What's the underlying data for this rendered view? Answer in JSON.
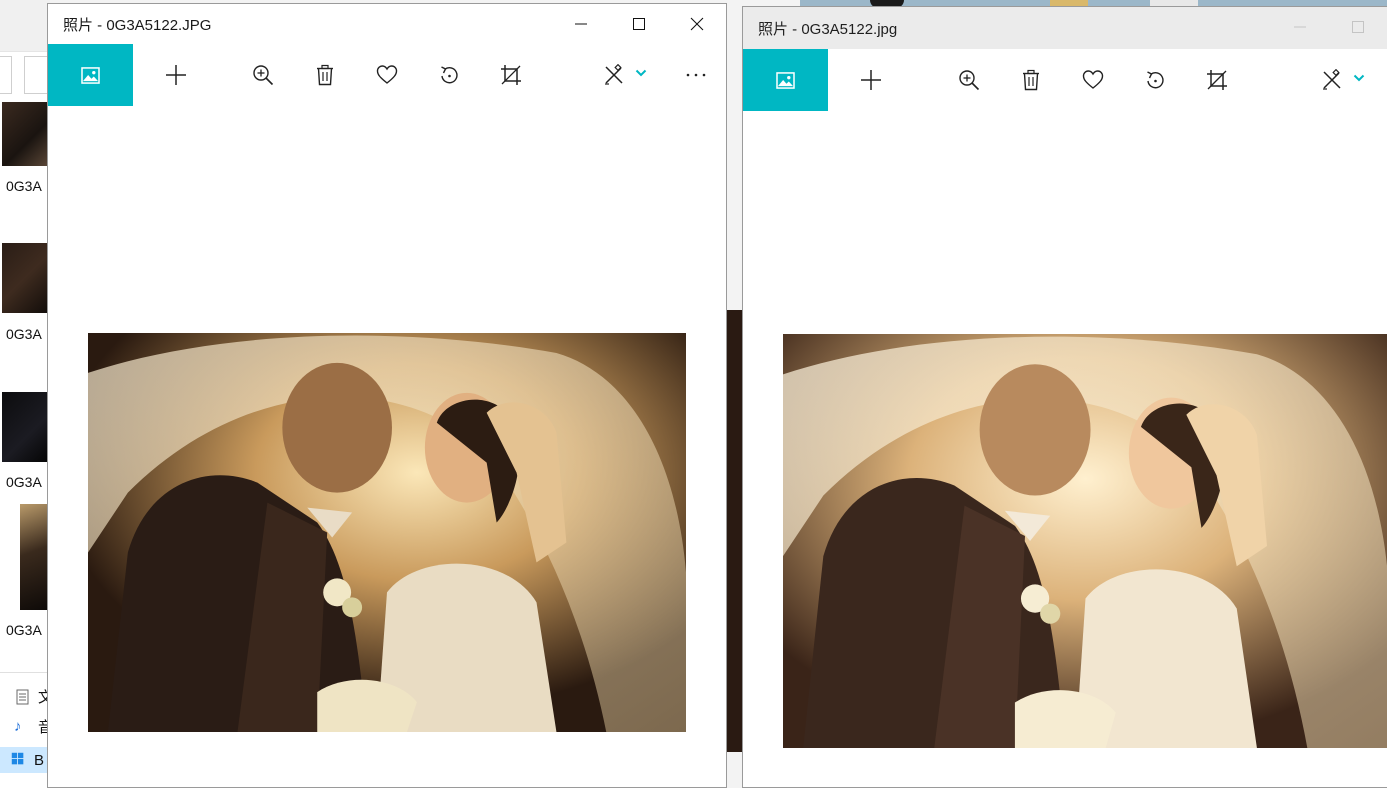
{
  "explorer": {
    "thumbnails": [
      {
        "label": "0G3A"
      },
      {
        "label": "0G3A"
      },
      {
        "label": "0G3A"
      },
      {
        "label": "0G3A"
      }
    ],
    "sidebar": [
      {
        "label": "文",
        "icon": "document-icon"
      },
      {
        "label": "音",
        "icon": "music-note-icon"
      },
      {
        "label": "B",
        "icon": "windows-drive-icon"
      }
    ]
  },
  "left_window": {
    "title": "照片 - 0G3A5122.JPG",
    "toolbar": [
      "home-image",
      "add",
      "zoom-in",
      "delete",
      "favorite",
      "rotate",
      "crop",
      "edit-draw",
      "more"
    ],
    "photo_alt": "wedding photo"
  },
  "right_window": {
    "title": "照片 - 0G3A5122.jpg",
    "toolbar": [
      "home-image",
      "add",
      "zoom-in",
      "delete",
      "favorite",
      "rotate",
      "crop",
      "edit-draw"
    ],
    "photo_alt": "wedding photo"
  },
  "colors": {
    "accent": "#00b7c3",
    "titlebar_inactive": "#ebebeb"
  }
}
